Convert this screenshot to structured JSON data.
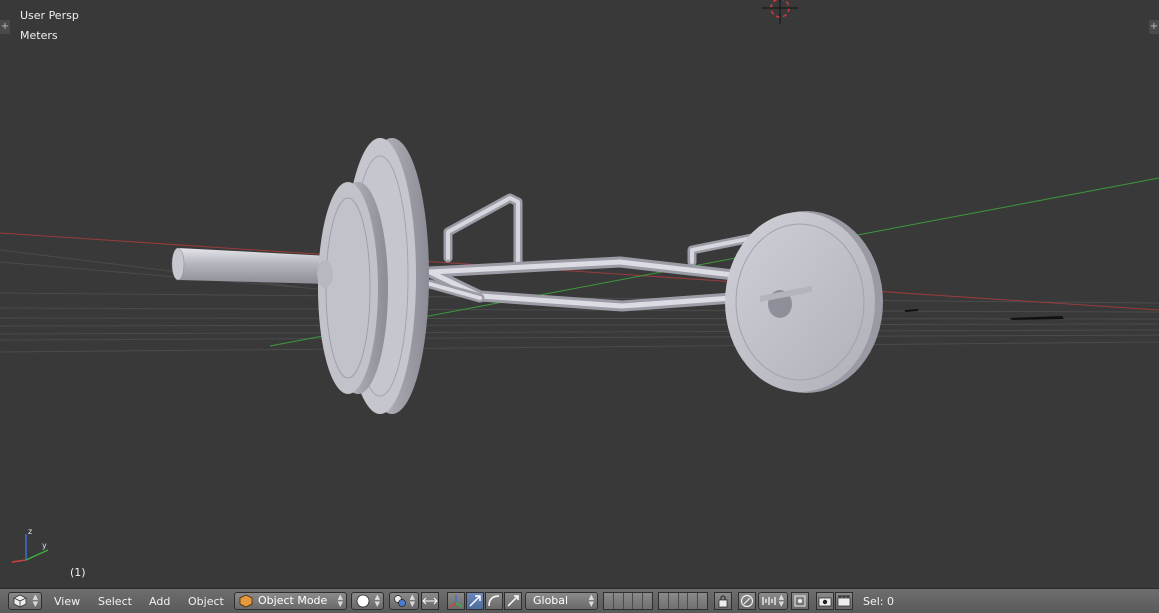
{
  "viewport": {
    "view_label": "User Persp",
    "units_label": "Meters",
    "frame_label": "(1)",
    "gizmo": {
      "z_label": "z",
      "y_label": "y"
    }
  },
  "header": {
    "menus": [
      "View",
      "Select",
      "Add",
      "Object"
    ],
    "mode": "Object Mode",
    "transform_orientation": "Global",
    "selection_status": "Sel: 0"
  },
  "colors": {
    "viewport_bg": "#393939",
    "x_axis": "#9a3b3b",
    "y_axis": "#3c9a3c",
    "mesh": "#c4c4cc",
    "active_button": "#5a7bb0"
  },
  "icons": {
    "editor_type": "cube-icon",
    "mode": "object-mode-cube-icon",
    "shading": "solid-shading-icon",
    "pivot": "pivot-point-icon",
    "manipulator": "manipulator-axes-icon",
    "translate": "translate-arrow-icon",
    "rotate": "rotate-arc-icon",
    "scale": "scale-icon",
    "lock": "layer-lock-icon",
    "proportional": "proportional-edit-icon",
    "snap": "snap-magnet-icon",
    "snap_element": "snap-increment-icon",
    "render": "render-camera-icon",
    "render_anim": "render-animation-icon"
  }
}
